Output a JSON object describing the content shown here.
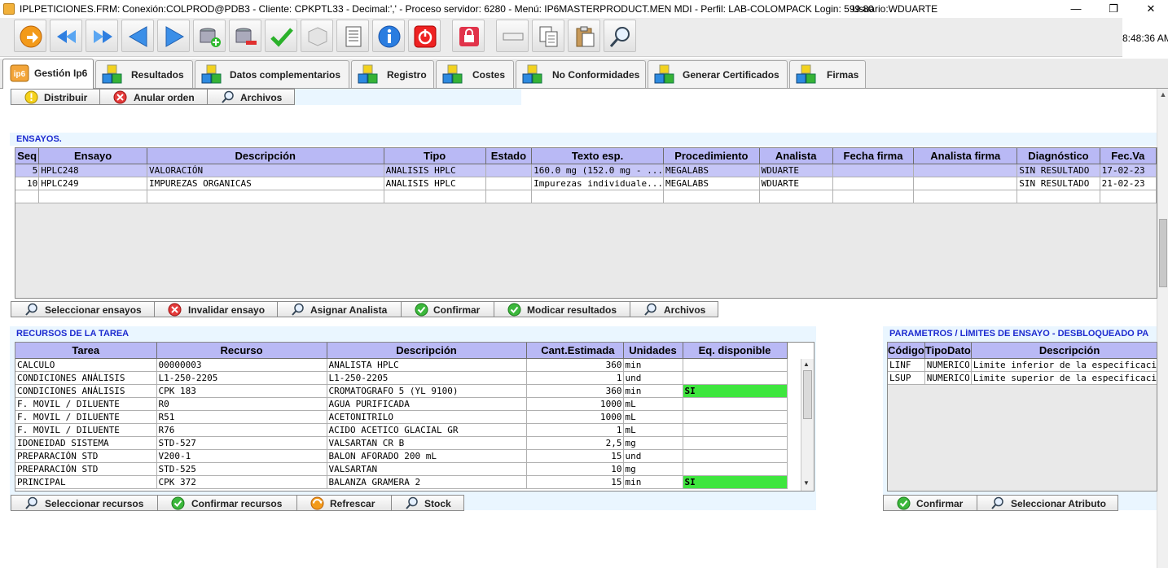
{
  "window": {
    "title": "IPLPETICIONES.FRM:",
    "status": "Conexión:COLPROD@PDB3 - Cliente: CPKPTL33 - Decimal:',' - Proceso servidor: 6280 - Menú: IP6MASTERPRODUCT.MEN MDI - Perfil: LAB-COLOMPACK Login: 599.80",
    "user": "Usuario:WDUARTE",
    "minimize": "—",
    "maximize": "❐",
    "close": "✕"
  },
  "toolbar": {
    "buttons": [
      "exit-icon",
      "first-icon",
      "previous-icon",
      "next-icon",
      "last-icon",
      "add-record-icon",
      "delete-record-icon",
      "check-icon",
      "cube-icon",
      "print-icon",
      "info-icon",
      "power-icon",
      "lock-icon",
      "bar-icon",
      "copy-icon",
      "paste-icon",
      "search-icon"
    ],
    "clock": "8:48:36 AM"
  },
  "tabs": [
    "Gestión Ip6",
    "Resultados",
    "Datos complementarios",
    "Registro",
    "Costes",
    "No Conformidades",
    "Generar Certificados",
    "Firmas"
  ],
  "top_buttons": {
    "distribuir": "Distribuir",
    "anular": "Anular orden",
    "archivos": "Archivos"
  },
  "ensayos": {
    "title": "ENSAYOS.",
    "columns": [
      "Seq",
      "Ensayo",
      "Descripción",
      "Tipo",
      "Estado",
      "Texto esp.",
      "Procedimiento",
      "Analista",
      "Fecha firma",
      "Analista firma",
      "Diagnóstico",
      "Fec.Va"
    ],
    "rows": [
      [
        "5",
        "HPLC248",
        "VALORACIÓN",
        "ANALISIS HPLC",
        "",
        "160.0 mg (152.0 mg - ...",
        "MEGALABS",
        "WDUARTE",
        "",
        "",
        "SIN RESULTADO",
        "17-02-23"
      ],
      [
        "10",
        "HPLC249",
        "IMPUREZAS ORGANICAS",
        "ANALISIS HPLC",
        "",
        "Impurezas individuale...",
        "MEGALABS",
        "WDUARTE",
        "",
        "",
        "SIN RESULTADO",
        "21-02-23"
      ]
    ],
    "buttons": {
      "seleccionar": "Seleccionar ensayos",
      "invalidar": "Invalidar ensayo",
      "asignar": "Asignar Analista",
      "confirmar": "Confirmar",
      "modificar": "Modicar resultados",
      "archivos": "Archivos"
    }
  },
  "recursos": {
    "title": "RECURSOS DE LA TAREA",
    "columns": [
      "Tarea",
      "Recurso",
      "Descripción",
      "Cant.Estimada",
      "Unidades",
      "Eq. disponible"
    ],
    "rows": [
      [
        "CALCULO",
        "00000003",
        "ANALISTA HPLC",
        "360",
        "min",
        ""
      ],
      [
        "CONDICIONES ANÁLISIS",
        "L1-250-2205",
        "L1-250-2205",
        "1",
        "und",
        ""
      ],
      [
        "CONDICIONES ANÁLISIS",
        "CPK 183",
        "CROMATOGRAFO 5 (YL 9100)",
        "360",
        "min",
        "SI"
      ],
      [
        "F. MOVIL / DILUENTE",
        "R0",
        "AGUA PURIFICADA",
        "1000",
        "mL",
        ""
      ],
      [
        "F. MOVIL / DILUENTE",
        "R51",
        "ACETONITRILO",
        "1000",
        "mL",
        ""
      ],
      [
        "F. MOVIL / DILUENTE",
        "R76",
        "ACIDO ACETICO GLACIAL GR",
        "1",
        "mL",
        ""
      ],
      [
        "IDONEIDAD SISTEMA",
        "STD-527",
        "VALSARTAN CR B",
        "2,5",
        "mg",
        ""
      ],
      [
        "PREPARACIÓN STD",
        "V200-1",
        "BALON AFORADO 200 mL",
        "15",
        "und",
        ""
      ],
      [
        "PREPARACIÓN STD",
        "STD-525",
        "VALSARTAN",
        "10",
        "mg",
        ""
      ],
      [
        "PRINCIPAL",
        "CPK 372",
        "BALANZA GRAMERA 2",
        "15",
        "min",
        "SI"
      ]
    ],
    "buttons": {
      "seleccionar": "Seleccionar recursos",
      "confirmar": "Confirmar recursos",
      "refrescar": "Refrescar",
      "stock": "Stock"
    }
  },
  "parametros": {
    "title": "PARAMETROS / LÍMITES DE ENSAYO - DESBLOQUEADO PA",
    "columns": [
      "Código",
      "TipoDato",
      "Descripción"
    ],
    "rows": [
      [
        "LINF",
        "NUMERICO",
        "Limite inferior de la especificación"
      ],
      [
        "LSUP",
        "NUMERICO",
        "Limite superior de la especificación"
      ]
    ],
    "buttons": {
      "confirmar": "Confirmar",
      "seleccionar_atributo": "Seleccionar Atributo"
    }
  },
  "colors": {
    "header": "#b9b9f5",
    "selected_row": "#c6c6f7",
    "available": "#3ee63e",
    "section_title": "#1d2bd0",
    "strip": "#eaf6ff"
  }
}
